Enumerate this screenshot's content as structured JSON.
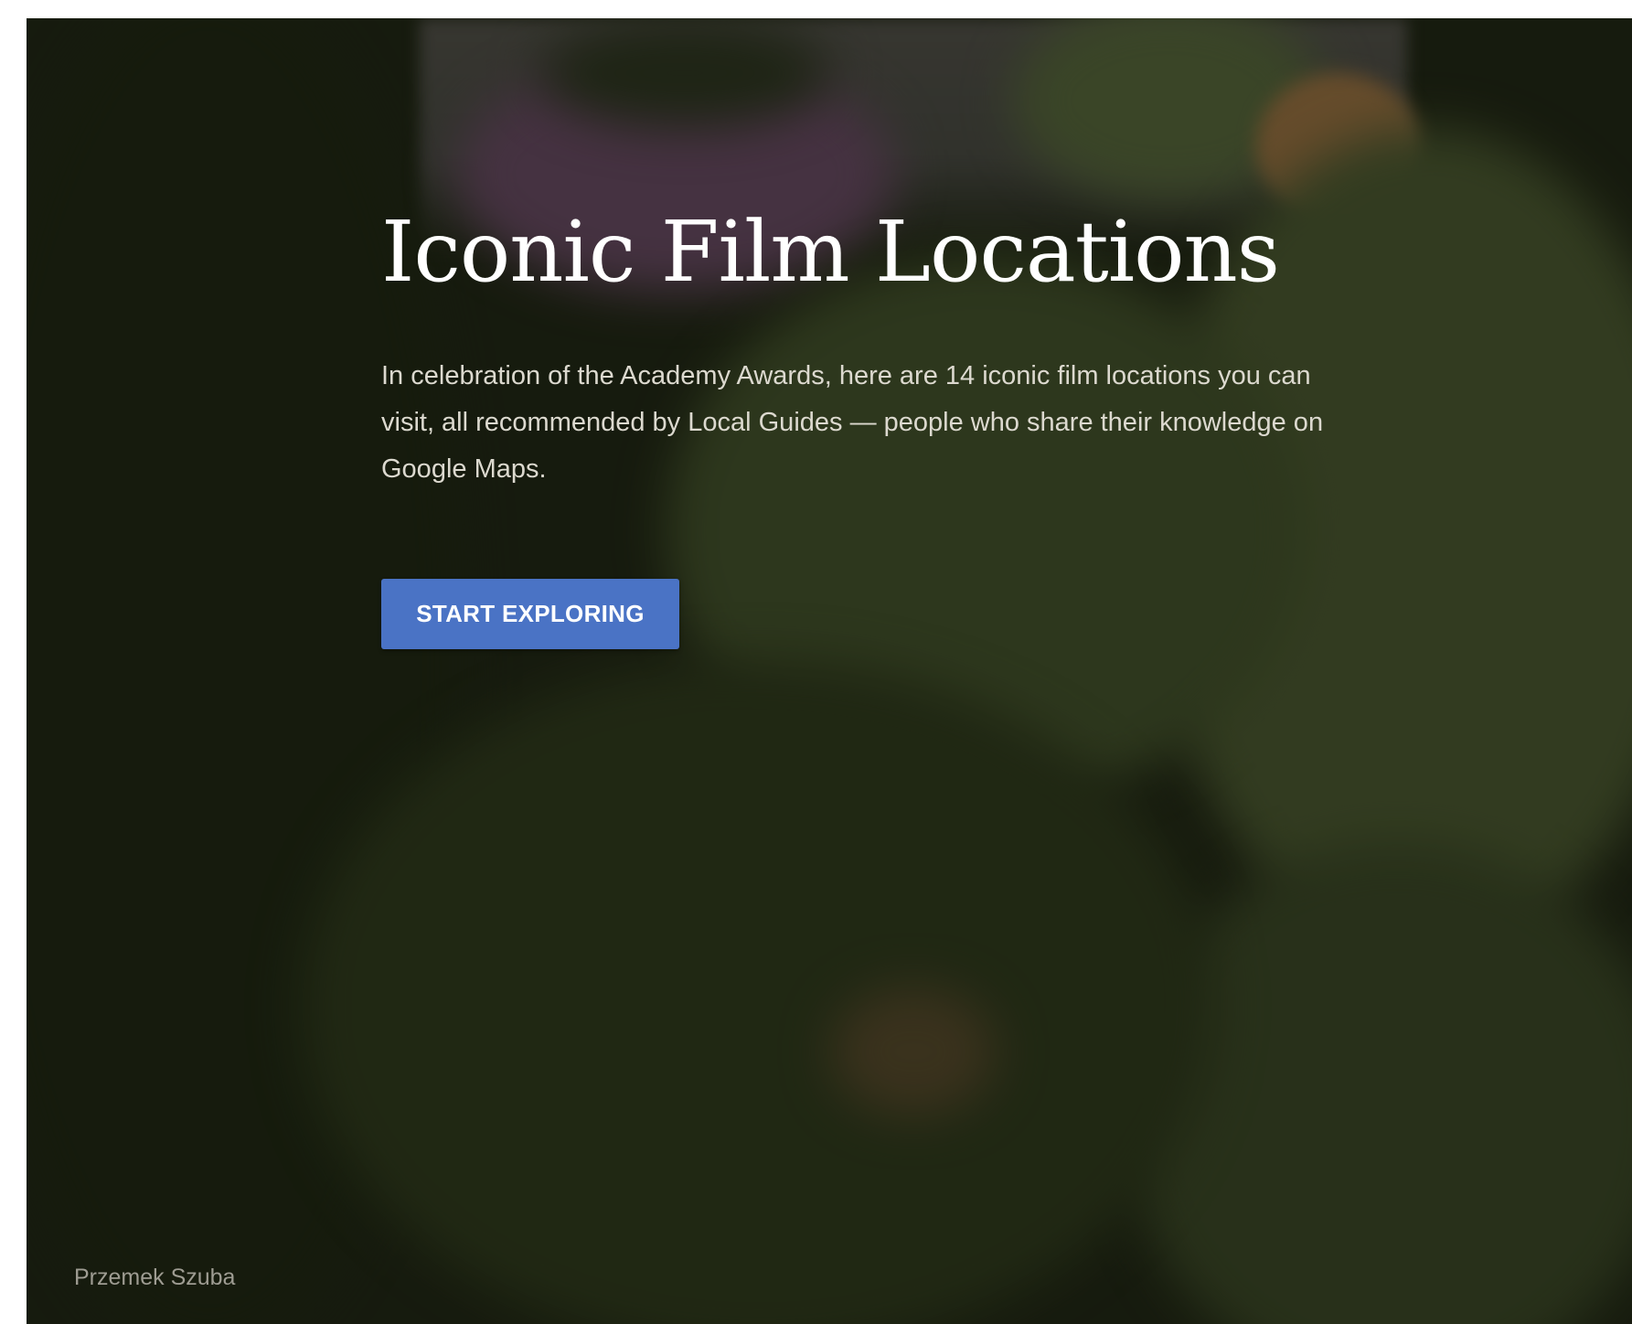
{
  "hero": {
    "title": "Iconic Film Locations",
    "intro": "In celebration of the Academy Awards, here are 14 iconic film locations you can visit, all recommended by Local Guides — people who share their knowledge on Google Maps.",
    "cta_label": "START EXPLORING",
    "photo_credit": "Przemek Szuba"
  },
  "colors": {
    "button": "#4a73c5",
    "title": "#ffffff",
    "body_text": "#dcd9cf",
    "credit": "#9e9c92",
    "overlay": "#0e1008"
  }
}
